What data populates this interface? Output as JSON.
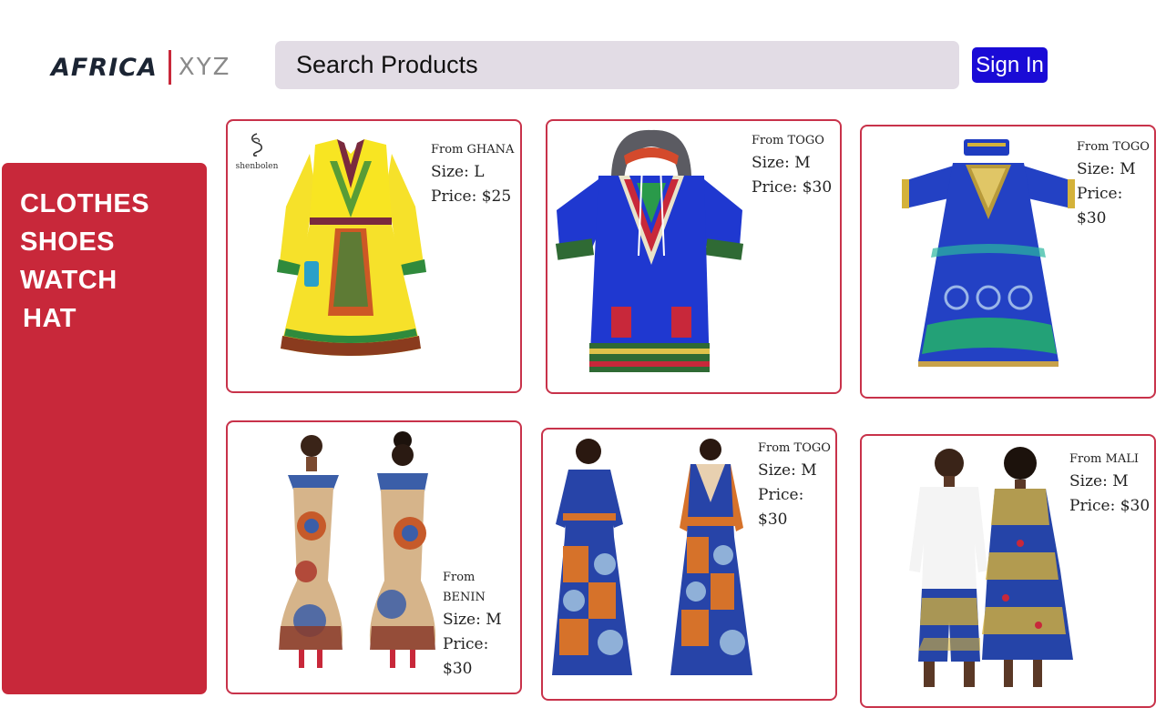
{
  "header": {
    "logo_main": "AFRICA",
    "logo_sub": "XYZ",
    "search_placeholder": "Search Products",
    "signin_label": "Sign In"
  },
  "sidebar": {
    "items": [
      {
        "label": "CLOTHES"
      },
      {
        "label": "SHOES"
      },
      {
        "label": "WATCH"
      },
      {
        "label": "HAT"
      }
    ]
  },
  "products": [
    {
      "from": "From GHANA",
      "size": "Size: L",
      "price": "Price: $25",
      "brand": "shenbolen",
      "image": "yellow-dashiki-dress-image"
    },
    {
      "from": "From TOGO",
      "size": "Size: M",
      "price": "Price: $30",
      "image": "blue-hooded-dashiki-shirt-image"
    },
    {
      "from": "From TOGO",
      "size": "Size: M",
      "price": "Price: $30",
      "image": "blue-embroidered-robe-image"
    },
    {
      "from": "From BENIN",
      "size": "Size: M",
      "price": "Price: $30",
      "image": "mermaid-print-dress-image"
    },
    {
      "from": "From TOGO",
      "size": "Size: M",
      "price": "Price: $30",
      "image": "wrap-maxi-dress-image"
    },
    {
      "from": "From MALI",
      "size": "Size: M",
      "price": "Price: $30",
      "image": "couple-matching-outfit-image"
    }
  ],
  "colors": {
    "accent_red": "#c8283a",
    "button_blue": "#1a0bd6",
    "search_bg": "#e2dce5"
  }
}
